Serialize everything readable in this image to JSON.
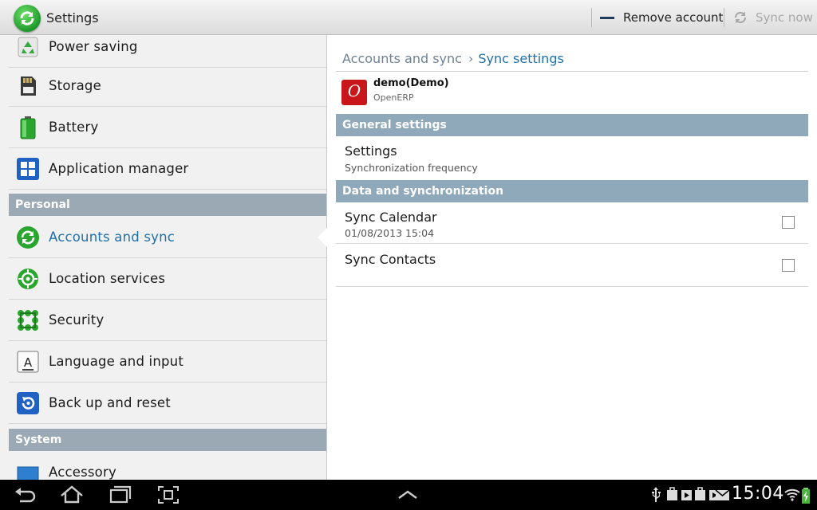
{
  "actionbar": {
    "title": "Settings",
    "remove_account_label": "Remove account",
    "sync_now_label": "Sync now",
    "app_icon": "sync-settings-icon",
    "sync_icon": "refresh-icon",
    "remove_icon": "minus-icon"
  },
  "sidebar": {
    "items_top": [
      {
        "label": "Power saving",
        "icon": "recycle-icon"
      },
      {
        "label": "Storage",
        "icon": "sd-card-icon"
      },
      {
        "label": "Battery",
        "icon": "battery-icon"
      },
      {
        "label": "Application manager",
        "icon": "grid-icon"
      }
    ],
    "personal_header": "Personal",
    "items_personal": [
      {
        "label": "Accounts and sync",
        "icon": "sync-icon",
        "active": true
      },
      {
        "label": "Location services",
        "icon": "location-target-icon"
      },
      {
        "label": "Security",
        "icon": "dots-grid-icon"
      },
      {
        "label": "Language and input",
        "icon": "keyboard-letter-icon"
      },
      {
        "label": "Back up and reset",
        "icon": "restore-icon"
      }
    ],
    "system_header": "System",
    "items_system": [
      {
        "label": "Accessory",
        "icon": "accessory-icon"
      }
    ]
  },
  "detail": {
    "breadcrumb_parent": "Accounts and sync",
    "breadcrumb_current": "Sync settings",
    "account": {
      "name": "demo(Demo)",
      "type": "OpenERP",
      "icon_letter": "O"
    },
    "general_header": "General settings",
    "settings_title": "Settings",
    "settings_subtitle": "Synchronization frequency",
    "data_header": "Data and synchronization",
    "sync_calendar": {
      "title": "Sync Calendar",
      "subtitle": "01/08/2013 15:04",
      "checked": false
    },
    "sync_contacts": {
      "title": "Sync Contacts",
      "checked": false
    }
  },
  "statusbar": {
    "time": "15:04"
  },
  "colors": {
    "accent": "#1f6fa8",
    "section_header": "#8fa8ba",
    "account_icon": "#c8161b"
  }
}
